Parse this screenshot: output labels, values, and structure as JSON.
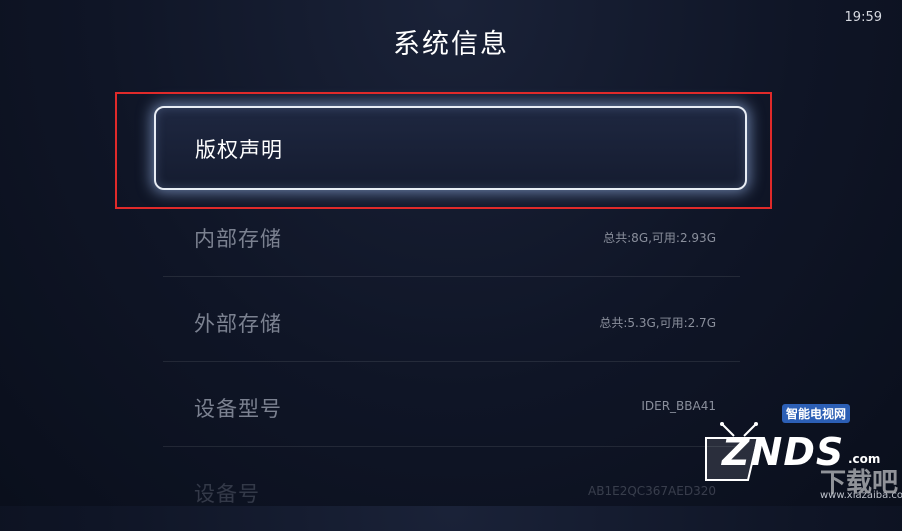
{
  "status_bar": {
    "time": "19:59"
  },
  "page": {
    "title": "系统信息"
  },
  "menu": {
    "selected": {
      "label": "版权声明"
    },
    "items": [
      {
        "label": "内部存储",
        "value": "总共:8G,可用:2.93G"
      },
      {
        "label": "外部存储",
        "value": "总共:5.3G,可用:2.7G"
      },
      {
        "label": "设备型号",
        "value": "IDER_BBA41"
      },
      {
        "label": "设备号",
        "value": "AB1E2QC367AED320"
      }
    ]
  },
  "watermark": {
    "subtitle": "智能电视网",
    "brand": "ZNDS",
    "brand_suffix": ".com",
    "site": "www.xiazaiba.com",
    "site_logo": "下载吧"
  },
  "colors": {
    "background": "#0f1526",
    "annotation_border": "#e02a2a",
    "selected_glow": "#aac8ff"
  }
}
